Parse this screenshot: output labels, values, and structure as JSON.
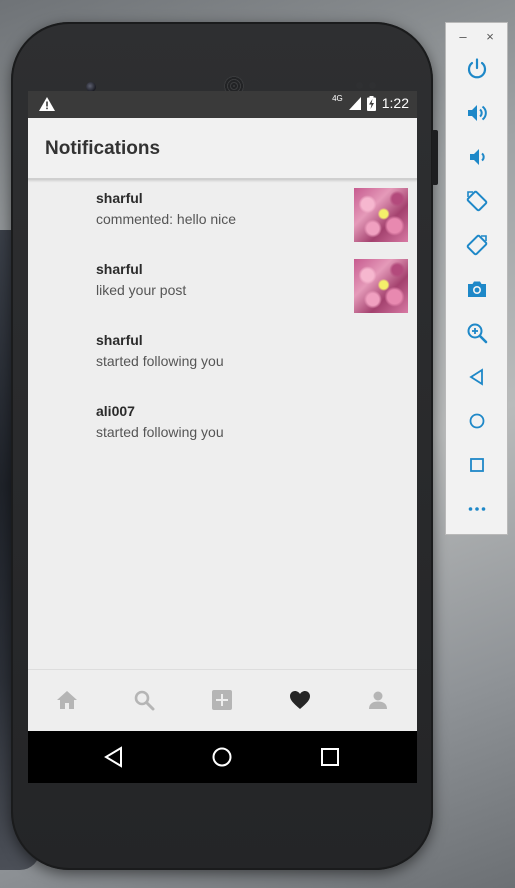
{
  "status_bar": {
    "network": "4G",
    "time": "1:22"
  },
  "app_bar": {
    "title": "Notifications"
  },
  "notifications": [
    {
      "user": "sharful",
      "message": "commented: hello nice",
      "has_thumbnail": true
    },
    {
      "user": "sharful",
      "message": "liked your post",
      "has_thumbnail": true
    },
    {
      "user": "sharful",
      "message": "started following you",
      "has_thumbnail": false
    },
    {
      "user": "ali007",
      "message": "started following you",
      "has_thumbnail": false
    }
  ],
  "bottom_nav": {
    "items": [
      "home-icon",
      "search-icon",
      "add-post-icon",
      "heart-icon",
      "profile-icon"
    ],
    "active": "heart-icon",
    "inactive_color": "#b5b5b5",
    "active_color": "#262626"
  },
  "emulator_toolbar": {
    "controls": [
      "minimize",
      "close"
    ],
    "minimize_label": "–",
    "close_label": "×",
    "buttons": [
      "power-icon",
      "volume-up-icon",
      "volume-down-icon",
      "rotate-left-icon",
      "rotate-right-icon",
      "camera-icon",
      "zoom-icon",
      "back-icon",
      "home-icon",
      "overview-icon",
      "more-icon"
    ],
    "icon_color": "#1e88c8"
  }
}
